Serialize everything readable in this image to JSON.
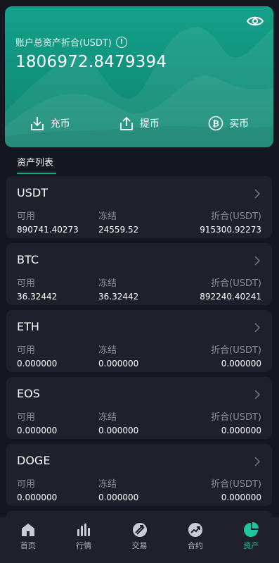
{
  "hero": {
    "total_label": "账户总资产折合(USDT)",
    "total_value": "1806972.8479394",
    "actions": [
      {
        "label": "充币",
        "icon": "deposit-icon"
      },
      {
        "label": "提币",
        "icon": "withdraw-icon"
      },
      {
        "label": "买币",
        "icon": "bitcoin-icon"
      }
    ]
  },
  "section_title": "资产列表",
  "assets": [
    {
      "name": "USDT",
      "available_label": "可用",
      "frozen_label": "冻结",
      "equiv_label": "折合(USDT)",
      "available": "890741.40273",
      "frozen": "24559.52",
      "equiv": "915300.92273"
    },
    {
      "name": "BTC",
      "available_label": "可用",
      "frozen_label": "冻结",
      "equiv_label": "折合(USDT)",
      "available": "36.32442",
      "frozen": "36.32442",
      "equiv": "892240.40241"
    },
    {
      "name": "ETH",
      "available_label": "可用",
      "frozen_label": "冻结",
      "equiv_label": "折合(USDT)",
      "available": "0.000000",
      "frozen": "0.000000",
      "equiv": "0.000000"
    },
    {
      "name": "EOS",
      "available_label": "可用",
      "frozen_label": "冻结",
      "equiv_label": "折合(USDT)",
      "available": "0.000000",
      "frozen": "0.000000",
      "equiv": "0.000000"
    },
    {
      "name": "DOGE",
      "available_label": "可用",
      "frozen_label": "冻结",
      "equiv_label": "折合(USDT)",
      "available": "0.000000",
      "frozen": "0.000000",
      "equiv": "0.000000"
    }
  ],
  "tabs": [
    {
      "label": "首页",
      "icon": "home-icon",
      "active": false
    },
    {
      "label": "行情",
      "icon": "market-icon",
      "active": false
    },
    {
      "label": "交易",
      "icon": "trade-icon",
      "active": false
    },
    {
      "label": "合约",
      "icon": "contract-icon",
      "active": false
    },
    {
      "label": "资产",
      "icon": "assets-icon",
      "active": true
    }
  ],
  "colors": {
    "accent": "#1fc59f",
    "hero": "#0f8f79",
    "card": "#1e212c",
    "background": "#141720"
  }
}
